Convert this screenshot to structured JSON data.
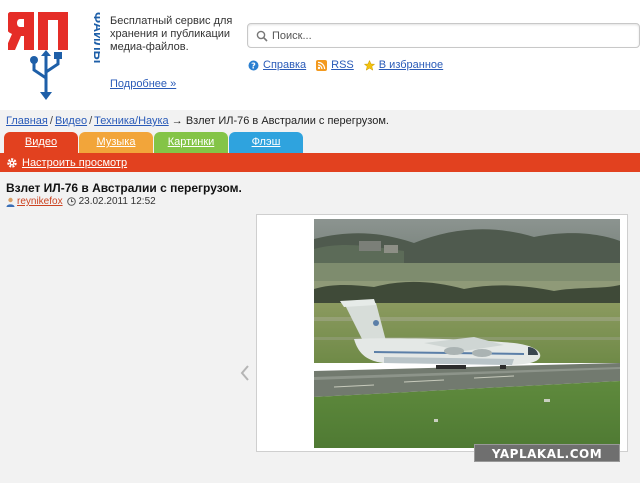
{
  "header": {
    "logo_letters": "ЯП",
    "logo_vertical": "ФАЙЛЫ",
    "tagline": "Бесплатный сервис для хранения и публикации медиа-файлов.",
    "more_link": "Подробнее »",
    "search_placeholder": "Поиск...",
    "links": [
      {
        "label": "Справка",
        "icon": "help-icon"
      },
      {
        "label": "RSS",
        "icon": "rss-icon"
      },
      {
        "label": "В избранное",
        "icon": "star-icon"
      }
    ]
  },
  "breadcrumb": {
    "items": [
      "Главная",
      "Видео",
      "Техника/Наука"
    ],
    "separator": "/",
    "arrow": "→",
    "current": "Взлет ИЛ-76 в Австралии с перегрузом."
  },
  "tabs": [
    {
      "label": "Видео",
      "color": "#e2411f"
    },
    {
      "label": "Музыка",
      "color": "#f2a53a"
    },
    {
      "label": "Картинки",
      "color": "#84c447"
    },
    {
      "label": "Флэш",
      "color": "#2fa3de"
    }
  ],
  "settings_bar": {
    "label": "Настроить просмотр",
    "icon": "gear-icon",
    "color": "#e2411f"
  },
  "post": {
    "title": "Взлет ИЛ-76 в Австралии с перегрузом.",
    "author": "reynikefox",
    "datetime": "23.02.2011 12:52"
  },
  "viewer": {
    "prev_icon": "chevron-left-icon",
    "watermark": "YAPLAKAL.COM"
  },
  "colors": {
    "accent_red": "#e2411f",
    "link_blue": "#2a5bb8",
    "logo_red": "#e52d27",
    "logo_blue": "#1e5fa8"
  }
}
